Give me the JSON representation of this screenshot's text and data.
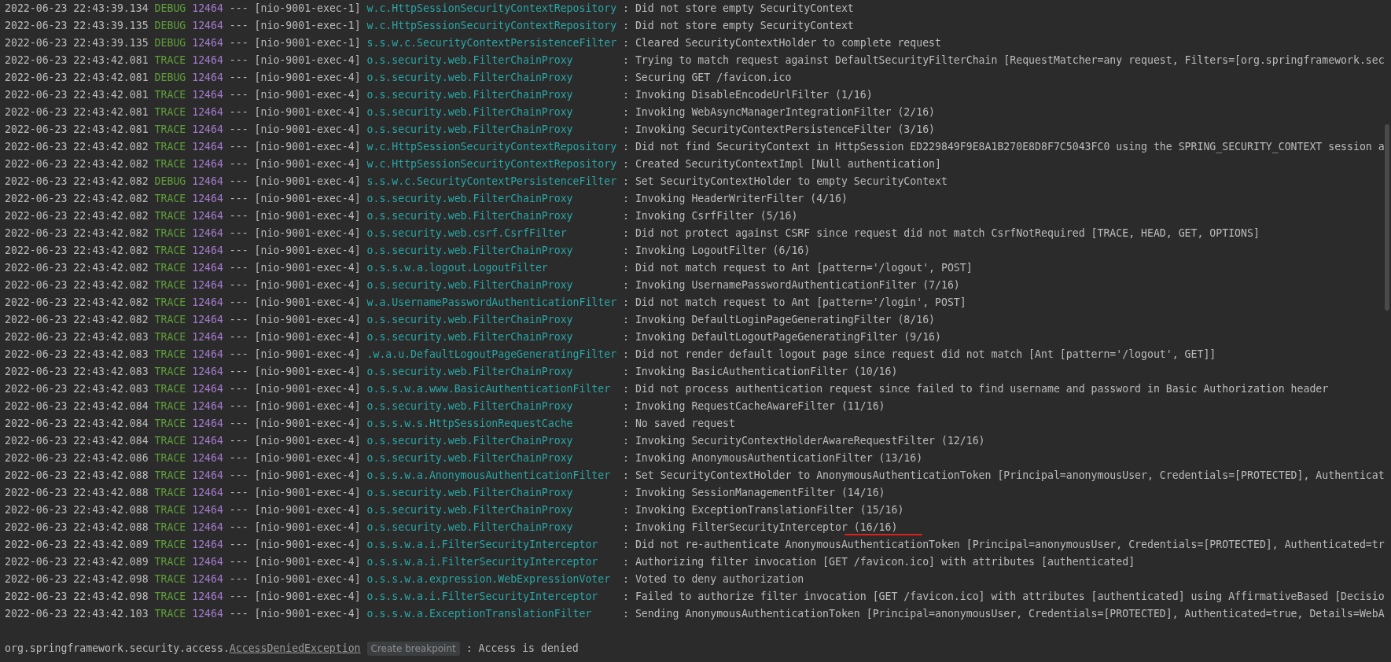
{
  "console": {
    "rows": [
      {
        "time": "2022-06-23 22:43:39.134",
        "level": "DEBUG",
        "pid": "12464",
        "sep": "---",
        "thread": "[nio-9001-exec-1]",
        "logger": "w.c.HttpSessionSecurityContextRepository",
        "message": ": Did not store empty SecurityContext",
        "underlined": false
      },
      {
        "time": "2022-06-23 22:43:39.135",
        "level": "DEBUG",
        "pid": "12464",
        "sep": "---",
        "thread": "[nio-9001-exec-1]",
        "logger": "w.c.HttpSessionSecurityContextRepository",
        "message": ": Did not store empty SecurityContext",
        "underlined": false
      },
      {
        "time": "2022-06-23 22:43:39.135",
        "level": "DEBUG",
        "pid": "12464",
        "sep": "---",
        "thread": "[nio-9001-exec-1]",
        "logger": "s.s.w.c.SecurityContextPersistenceFilter",
        "message": ": Cleared SecurityContextHolder to complete request",
        "underlined": false
      },
      {
        "time": "2022-06-23 22:43:42.081",
        "level": "TRACE",
        "pid": "12464",
        "sep": "---",
        "thread": "[nio-9001-exec-4]",
        "logger": "o.s.security.web.FilterChainProxy",
        "message": ": Trying to match request against DefaultSecurityFilterChain [RequestMatcher=any request, Filters=[org.springframework.sec",
        "underlined": false
      },
      {
        "time": "2022-06-23 22:43:42.081",
        "level": "DEBUG",
        "pid": "12464",
        "sep": "---",
        "thread": "[nio-9001-exec-4]",
        "logger": "o.s.security.web.FilterChainProxy",
        "message": ": Securing GET /favicon.ico",
        "underlined": false
      },
      {
        "time": "2022-06-23 22:43:42.081",
        "level": "TRACE",
        "pid": "12464",
        "sep": "---",
        "thread": "[nio-9001-exec-4]",
        "logger": "o.s.security.web.FilterChainProxy",
        "message": ": Invoking DisableEncodeUrlFilter (1/16)",
        "underlined": false
      },
      {
        "time": "2022-06-23 22:43:42.081",
        "level": "TRACE",
        "pid": "12464",
        "sep": "---",
        "thread": "[nio-9001-exec-4]",
        "logger": "o.s.security.web.FilterChainProxy",
        "message": ": Invoking WebAsyncManagerIntegrationFilter (2/16)",
        "underlined": false
      },
      {
        "time": "2022-06-23 22:43:42.081",
        "level": "TRACE",
        "pid": "12464",
        "sep": "---",
        "thread": "[nio-9001-exec-4]",
        "logger": "o.s.security.web.FilterChainProxy",
        "message": ": Invoking SecurityContextPersistenceFilter (3/16)",
        "underlined": false
      },
      {
        "time": "2022-06-23 22:43:42.082",
        "level": "TRACE",
        "pid": "12464",
        "sep": "---",
        "thread": "[nio-9001-exec-4]",
        "logger": "w.c.HttpSessionSecurityContextRepository",
        "message": ": Did not find SecurityContext in HttpSession ED229849F9E8A1B270E8D8F7C5043FC0 using the SPRING_SECURITY_CONTEXT session a",
        "underlined": false
      },
      {
        "time": "2022-06-23 22:43:42.082",
        "level": "TRACE",
        "pid": "12464",
        "sep": "---",
        "thread": "[nio-9001-exec-4]",
        "logger": "w.c.HttpSessionSecurityContextRepository",
        "message": ": Created SecurityContextImpl [Null authentication]",
        "underlined": false
      },
      {
        "time": "2022-06-23 22:43:42.082",
        "level": "DEBUG",
        "pid": "12464",
        "sep": "---",
        "thread": "[nio-9001-exec-4]",
        "logger": "s.s.w.c.SecurityContextPersistenceFilter",
        "message": ": Set SecurityContextHolder to empty SecurityContext",
        "underlined": false
      },
      {
        "time": "2022-06-23 22:43:42.082",
        "level": "TRACE",
        "pid": "12464",
        "sep": "---",
        "thread": "[nio-9001-exec-4]",
        "logger": "o.s.security.web.FilterChainProxy",
        "message": ": Invoking HeaderWriterFilter (4/16)",
        "underlined": false
      },
      {
        "time": "2022-06-23 22:43:42.082",
        "level": "TRACE",
        "pid": "12464",
        "sep": "---",
        "thread": "[nio-9001-exec-4]",
        "logger": "o.s.security.web.FilterChainProxy",
        "message": ": Invoking CsrfFilter (5/16)",
        "underlined": false
      },
      {
        "time": "2022-06-23 22:43:42.082",
        "level": "TRACE",
        "pid": "12464",
        "sep": "---",
        "thread": "[nio-9001-exec-4]",
        "logger": "o.s.security.web.csrf.CsrfFilter",
        "message": ": Did not protect against CSRF since request did not match CsrfNotRequired [TRACE, HEAD, GET, OPTIONS]",
        "underlined": false
      },
      {
        "time": "2022-06-23 22:43:42.082",
        "level": "TRACE",
        "pid": "12464",
        "sep": "---",
        "thread": "[nio-9001-exec-4]",
        "logger": "o.s.security.web.FilterChainProxy",
        "message": ": Invoking LogoutFilter (6/16)",
        "underlined": false
      },
      {
        "time": "2022-06-23 22:43:42.082",
        "level": "TRACE",
        "pid": "12464",
        "sep": "---",
        "thread": "[nio-9001-exec-4]",
        "logger": "o.s.s.w.a.logout.LogoutFilter",
        "message": ": Did not match request to Ant [pattern='/logout', POST]",
        "underlined": false
      },
      {
        "time": "2022-06-23 22:43:42.082",
        "level": "TRACE",
        "pid": "12464",
        "sep": "---",
        "thread": "[nio-9001-exec-4]",
        "logger": "o.s.security.web.FilterChainProxy",
        "message": ": Invoking UsernamePasswordAuthenticationFilter (7/16)",
        "underlined": false
      },
      {
        "time": "2022-06-23 22:43:42.082",
        "level": "TRACE",
        "pid": "12464",
        "sep": "---",
        "thread": "[nio-9001-exec-4]",
        "logger": "w.a.UsernamePasswordAuthenticationFilter",
        "message": ": Did not match request to Ant [pattern='/login', POST]",
        "underlined": false
      },
      {
        "time": "2022-06-23 22:43:42.082",
        "level": "TRACE",
        "pid": "12464",
        "sep": "---",
        "thread": "[nio-9001-exec-4]",
        "logger": "o.s.security.web.FilterChainProxy",
        "message": ": Invoking DefaultLoginPageGeneratingFilter (8/16)",
        "underlined": false
      },
      {
        "time": "2022-06-23 22:43:42.083",
        "level": "TRACE",
        "pid": "12464",
        "sep": "---",
        "thread": "[nio-9001-exec-4]",
        "logger": "o.s.security.web.FilterChainProxy",
        "message": ": Invoking DefaultLogoutPageGeneratingFilter (9/16)",
        "underlined": false
      },
      {
        "time": "2022-06-23 22:43:42.083",
        "level": "TRACE",
        "pid": "12464",
        "sep": "---",
        "thread": "[nio-9001-exec-4]",
        "logger": ".w.a.u.DefaultLogoutPageGeneratingFilter",
        "message": ": Did not render default logout page since request did not match [Ant [pattern='/logout', GET]]",
        "underlined": false
      },
      {
        "time": "2022-06-23 22:43:42.083",
        "level": "TRACE",
        "pid": "12464",
        "sep": "---",
        "thread": "[nio-9001-exec-4]",
        "logger": "o.s.security.web.FilterChainProxy",
        "message": ": Invoking BasicAuthenticationFilter (10/16)",
        "underlined": false
      },
      {
        "time": "2022-06-23 22:43:42.083",
        "level": "TRACE",
        "pid": "12464",
        "sep": "---",
        "thread": "[nio-9001-exec-4]",
        "logger": "o.s.s.w.a.www.BasicAuthenticationFilter",
        "message": ": Did not process authentication request since failed to find username and password in Basic Authorization header",
        "underlined": false
      },
      {
        "time": "2022-06-23 22:43:42.084",
        "level": "TRACE",
        "pid": "12464",
        "sep": "---",
        "thread": "[nio-9001-exec-4]",
        "logger": "o.s.security.web.FilterChainProxy",
        "message": ": Invoking RequestCacheAwareFilter (11/16)",
        "underlined": false
      },
      {
        "time": "2022-06-23 22:43:42.084",
        "level": "TRACE",
        "pid": "12464",
        "sep": "---",
        "thread": "[nio-9001-exec-4]",
        "logger": "o.s.s.w.s.HttpSessionRequestCache",
        "message": ": No saved request",
        "underlined": false
      },
      {
        "time": "2022-06-23 22:43:42.084",
        "level": "TRACE",
        "pid": "12464",
        "sep": "---",
        "thread": "[nio-9001-exec-4]",
        "logger": "o.s.security.web.FilterChainProxy",
        "message": ": Invoking SecurityContextHolderAwareRequestFilter (12/16)",
        "underlined": false
      },
      {
        "time": "2022-06-23 22:43:42.086",
        "level": "TRACE",
        "pid": "12464",
        "sep": "---",
        "thread": "[nio-9001-exec-4]",
        "logger": "o.s.security.web.FilterChainProxy",
        "message": ": Invoking AnonymousAuthenticationFilter (13/16)",
        "underlined": false
      },
      {
        "time": "2022-06-23 22:43:42.088",
        "level": "TRACE",
        "pid": "12464",
        "sep": "---",
        "thread": "[nio-9001-exec-4]",
        "logger": "o.s.s.w.a.AnonymousAuthenticationFilter",
        "message": ": Set SecurityContextHolder to AnonymousAuthenticationToken [Principal=anonymousUser, Credentials=[PROTECTED], Authenticat",
        "underlined": false
      },
      {
        "time": "2022-06-23 22:43:42.088",
        "level": "TRACE",
        "pid": "12464",
        "sep": "---",
        "thread": "[nio-9001-exec-4]",
        "logger": "o.s.security.web.FilterChainProxy",
        "message": ": Invoking SessionManagementFilter (14/16)",
        "underlined": false
      },
      {
        "time": "2022-06-23 22:43:42.088",
        "level": "TRACE",
        "pid": "12464",
        "sep": "---",
        "thread": "[nio-9001-exec-4]",
        "logger": "o.s.security.web.FilterChainProxy",
        "message": ": Invoking ExceptionTranslationFilter (15/16)",
        "underlined": false
      },
      {
        "time": "2022-06-23 22:43:42.088",
        "level": "TRACE",
        "pid": "12464",
        "sep": "---",
        "thread": "[nio-9001-exec-4]",
        "logger": "o.s.security.web.FilterChainProxy",
        "message": ": Invoking FilterSecurityInterceptor (16/16)",
        "underlined": true
      },
      {
        "time": "2022-06-23 22:43:42.089",
        "level": "TRACE",
        "pid": "12464",
        "sep": "---",
        "thread": "[nio-9001-exec-4]",
        "logger": "o.s.s.w.a.i.FilterSecurityInterceptor",
        "message": ": Did not re-authenticate AnonymousAuthenticationToken [Principal=anonymousUser, Credentials=[PROTECTED], Authenticated=tr",
        "underlined": false
      },
      {
        "time": "2022-06-23 22:43:42.089",
        "level": "TRACE",
        "pid": "12464",
        "sep": "---",
        "thread": "[nio-9001-exec-4]",
        "logger": "o.s.s.w.a.i.FilterSecurityInterceptor",
        "message": ": Authorizing filter invocation [GET /favicon.ico] with attributes [authenticated]",
        "underlined": false
      },
      {
        "time": "2022-06-23 22:43:42.098",
        "level": "TRACE",
        "pid": "12464",
        "sep": "---",
        "thread": "[nio-9001-exec-4]",
        "logger": "o.s.s.w.a.expression.WebExpressionVoter",
        "message": ": Voted to deny authorization",
        "underlined": false
      },
      {
        "time": "2022-06-23 22:43:42.098",
        "level": "TRACE",
        "pid": "12464",
        "sep": "---",
        "thread": "[nio-9001-exec-4]",
        "logger": "o.s.s.w.a.i.FilterSecurityInterceptor",
        "message": ": Failed to authorize filter invocation [GET /favicon.ico] with attributes [authenticated] using AffirmativeBased [Decisio",
        "underlined": false
      },
      {
        "time": "2022-06-23 22:43:42.103",
        "level": "TRACE",
        "pid": "12464",
        "sep": "---",
        "thread": "[nio-9001-exec-4]",
        "logger": "o.s.s.w.a.ExceptionTranslationFilter",
        "message": ": Sending AnonymousAuthenticationToken [Principal=anonymousUser, Credentials=[PROTECTED], Authenticated=true, Details=WebA",
        "underlined": false
      }
    ],
    "exception": {
      "package": "org.springframework.security.access.",
      "class_link": "AccessDeniedException",
      "hint": "Create breakpoint",
      "message": ": Access is denied"
    }
  }
}
